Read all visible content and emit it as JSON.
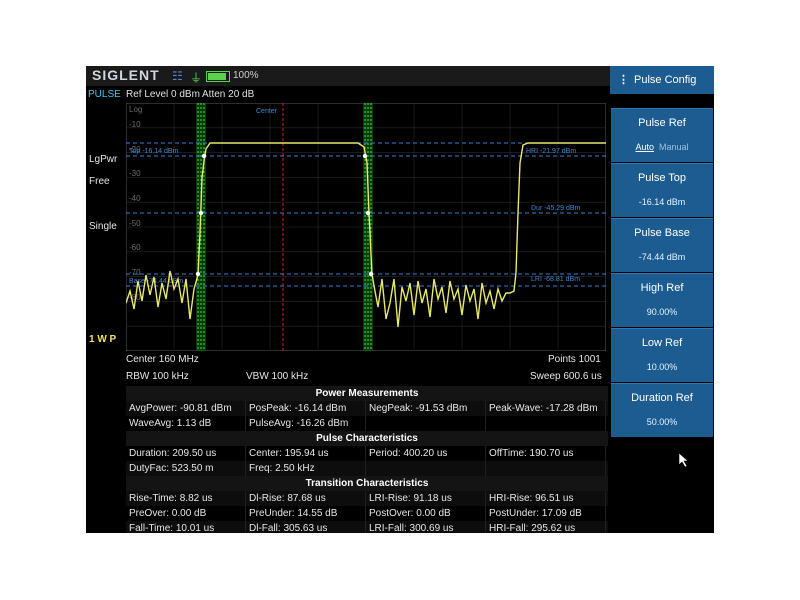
{
  "statusbar": {
    "brand": "SIGLENT",
    "battery_pct": "100%",
    "battery_level": 0.8
  },
  "header": {
    "mode": "PULSE",
    "ref_level": "Ref Level  0 dBm",
    "atten": "Atten  20 dB"
  },
  "side_labels": {
    "lgpwr": "LgPwr",
    "free": "Free",
    "single": "Single",
    "trace": "1 W P"
  },
  "plot": {
    "scale_top": "Log",
    "y_ticks": [
      "-10",
      "-20",
      "-30",
      "-40",
      "-50",
      "-60",
      "-70",
      "-80"
    ],
    "center_label": "Center",
    "top_ref": "Top -16.14 dBm",
    "base_ref": "Base -74.44 dBm",
    "hri_ref": "HRI -21.97 dBm",
    "dur_ref": "Dur -45.29 dBm",
    "lri_ref": "LRI -68.81 dBm"
  },
  "info": {
    "center": "Center  160 MHz",
    "points": "Points  1001",
    "rbw": "RBW  100 kHz",
    "vbw": "VBW  100 kHz",
    "sweep": "Sweep  600.6 us"
  },
  "table": {
    "power_title": "Power Measurements",
    "power_rows": [
      [
        "AvgPower: -90.81 dBm",
        "PosPeak: -16.14 dBm",
        "NegPeak: -91.53 dBm",
        "Peak-Wave: -17.28 dBm"
      ],
      [
        "WaveAvg: 1.13 dB",
        "PulseAvg: -16.26 dBm",
        "",
        ""
      ]
    ],
    "pulse_title": "Pulse Characteristics",
    "pulse_rows": [
      [
        "Duration: 209.50 us",
        "Center: 195.94 us",
        "Period: 400.20 us",
        "OffTime: 190.70 us"
      ],
      [
        "DutyFac: 523.50 m",
        "Freq: 2.50 kHz",
        "",
        ""
      ]
    ],
    "trans_title": "Transition Characteristics",
    "trans_rows": [
      [
        "Rise-Time: 8.82 us",
        "Dl-Rise: 87.68 us",
        "LRI-Rise: 91.18 us",
        "HRI-Rise: 96.51 us"
      ],
      [
        "PreOver: 0.00 dB",
        "PreUnder: 14.55 dB",
        "PostOver: 0.00 dB",
        "PostUnder: 17.09 dB"
      ],
      [
        "Fall-Time: 10.01 us",
        "Dl-Fall: 305.63 us",
        "LRI-Fall: 300.69 us",
        "HRI-Fall: 295.62 us"
      ]
    ]
  },
  "menu": {
    "title": "Pulse Config",
    "buttons": [
      {
        "label": "Pulse Ref",
        "auto": "Auto",
        "manual": "Manual"
      },
      {
        "label": "Pulse Top",
        "value": "-16.14 dBm"
      },
      {
        "label": "Pulse Base",
        "value": "-74.44 dBm"
      },
      {
        "label": "High Ref",
        "value": "90.00%"
      },
      {
        "label": "Low Ref",
        "value": "10.00%"
      },
      {
        "label": "Duration Ref",
        "value": "50.00%"
      }
    ]
  },
  "colors": {
    "trace": "#e8e86a",
    "accent": "#3bc7f0",
    "menu_bg": "#1d5c90",
    "ref_line": "#3a7fd0",
    "center_line": "#d02020"
  }
}
